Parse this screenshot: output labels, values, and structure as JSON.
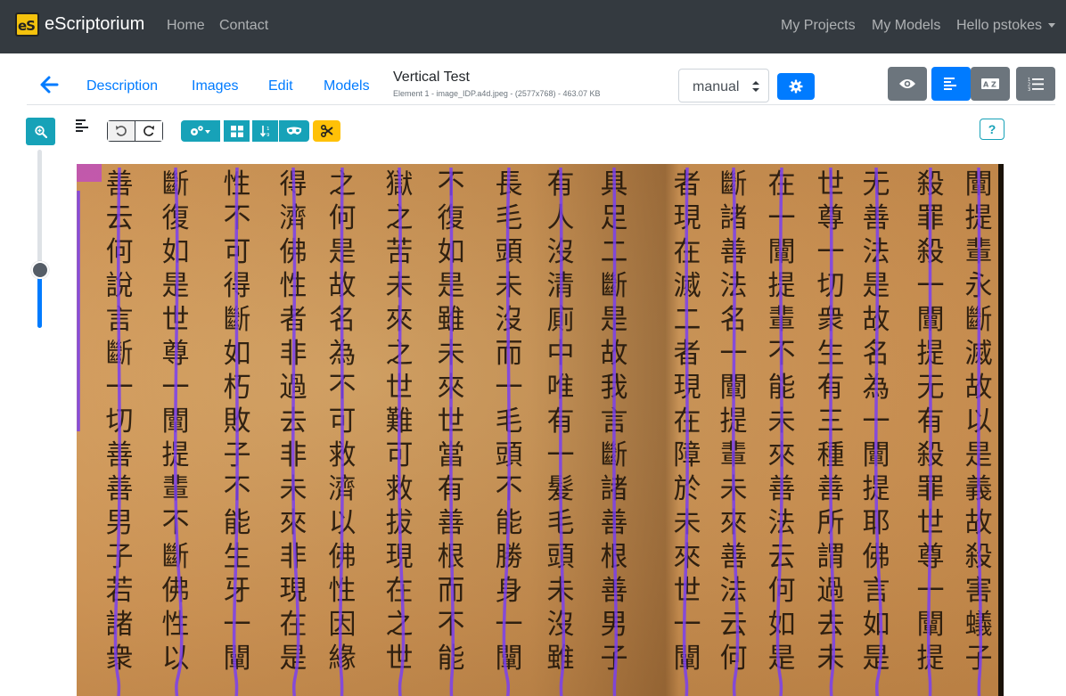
{
  "navbar": {
    "brand_logo": "eS",
    "brand_name": "eScriptorium",
    "links": [
      "Home",
      "Contact"
    ],
    "right_links": [
      "My Projects",
      "My Models"
    ],
    "user_menu": "Hello pstokes"
  },
  "tabs": {
    "items": [
      "Description",
      "Images",
      "Edit",
      "Models"
    ]
  },
  "document": {
    "title": "Vertical Test",
    "meta": "Element 1 - image_IDP.a4d.jpeg - (2577x768) - 463.07 KB"
  },
  "transcription_select": {
    "value": "manual"
  },
  "help": {
    "label": "?"
  },
  "icons": {
    "back": "arrow-left-icon",
    "settings": "gear-icon",
    "eye": "eye-icon",
    "segmentation": "align-left-icon",
    "transcription": "translate-icon",
    "list": "list-ordered-icon",
    "zoom": "zoom-in-icon",
    "undo": "undo-icon",
    "redo": "redo-icon",
    "cut": "scissors-icon"
  },
  "zoom_slider": {
    "level": 0.33
  },
  "colors": {
    "navbar": "#343a40",
    "primary": "#007bff",
    "info": "#17a2b8",
    "secondary": "#6c757d",
    "warning": "#ffc107",
    "baseline": "#7a3ff0"
  },
  "manuscript_columns": [
    "善云何說言斷一切善善男子若諸衆",
    "斷復如是世尊一闡提輩不斷佛性以",
    "性不可得斷如朽敗子不能生牙一闡",
    "得濟佛性者非過去非未來非現在是",
    "之何是故名為不可救濟以佛性因緣",
    "獄之苦未來之世難可救拔現在之世",
    "不復如是雖未來世當有善根而不能",
    "長毛頭未沒而一毛頭不能勝身一闡",
    "有人沒清廁中唯有一髮毛頭未沒雖",
    "具足二斷是故我言斷諸善根善男子",
    "者現在滅二者現在障於未來世一闡",
    "斷諸善法名一闡提輩未來善法云何",
    "在一闡提輩不能未來善法云何如是",
    "世尊一切衆生有三種善所謂過去未",
    "无善法是故名為一闡提耶佛言如是",
    "殺罪殺一闡提无有殺罪世尊一闡提",
    "闡提輩永斷滅故以是義故殺害蟻子"
  ]
}
